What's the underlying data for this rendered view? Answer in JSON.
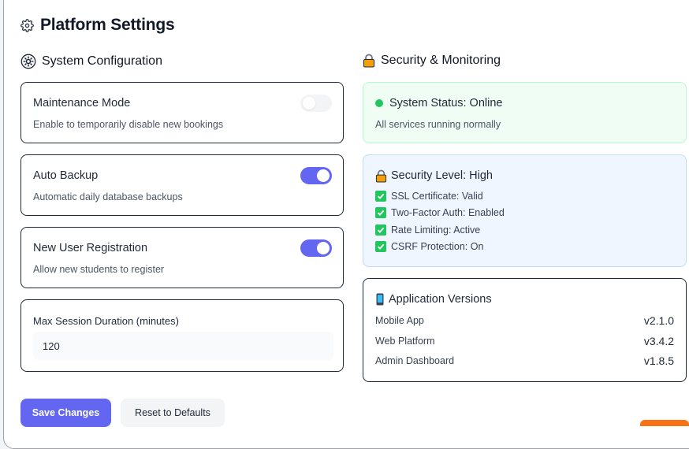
{
  "header": {
    "title": "Platform Settings",
    "icon": "gear-icon"
  },
  "system_config": {
    "title": "System Configuration",
    "icon": "gear-icon",
    "maintenance": {
      "title": "Maintenance Mode",
      "desc": "Enable to temporarily disable new bookings",
      "enabled": false
    },
    "auto_backup": {
      "title": "Auto Backup",
      "desc": "Automatic daily database backups",
      "enabled": true
    },
    "registration": {
      "title": "New User Registration",
      "desc": "Allow new students to register",
      "enabled": true
    },
    "session": {
      "label": "Max Session Duration (minutes)",
      "value": "120"
    }
  },
  "security": {
    "title": "Security & Monitoring",
    "icon": "lock-icon",
    "status": {
      "title": "System Status: Online",
      "desc": "All services running normally"
    },
    "level": {
      "title": "Security Level: High",
      "items": [
        "SSL Certificate: Valid",
        "Two-Factor Auth: Enabled",
        "Rate Limiting: Active",
        "CSRF Protection: On"
      ]
    },
    "versions": {
      "title": "Application Versions",
      "icon": "mobile-phone-icon",
      "rows": [
        {
          "name": "Mobile App",
          "value": "v2.1.0"
        },
        {
          "name": "Web Platform",
          "value": "v3.4.2"
        },
        {
          "name": "Admin Dashboard",
          "value": "v1.8.5"
        }
      ]
    }
  },
  "actions": {
    "save_label": "Save Changes",
    "reset_label": "Reset to Defaults"
  },
  "colors": {
    "accent": "#6366f1",
    "success": "#22c55e",
    "status_bg": "#f0fdf4",
    "security_bg": "#eff6ff",
    "orange": "#f97316"
  }
}
